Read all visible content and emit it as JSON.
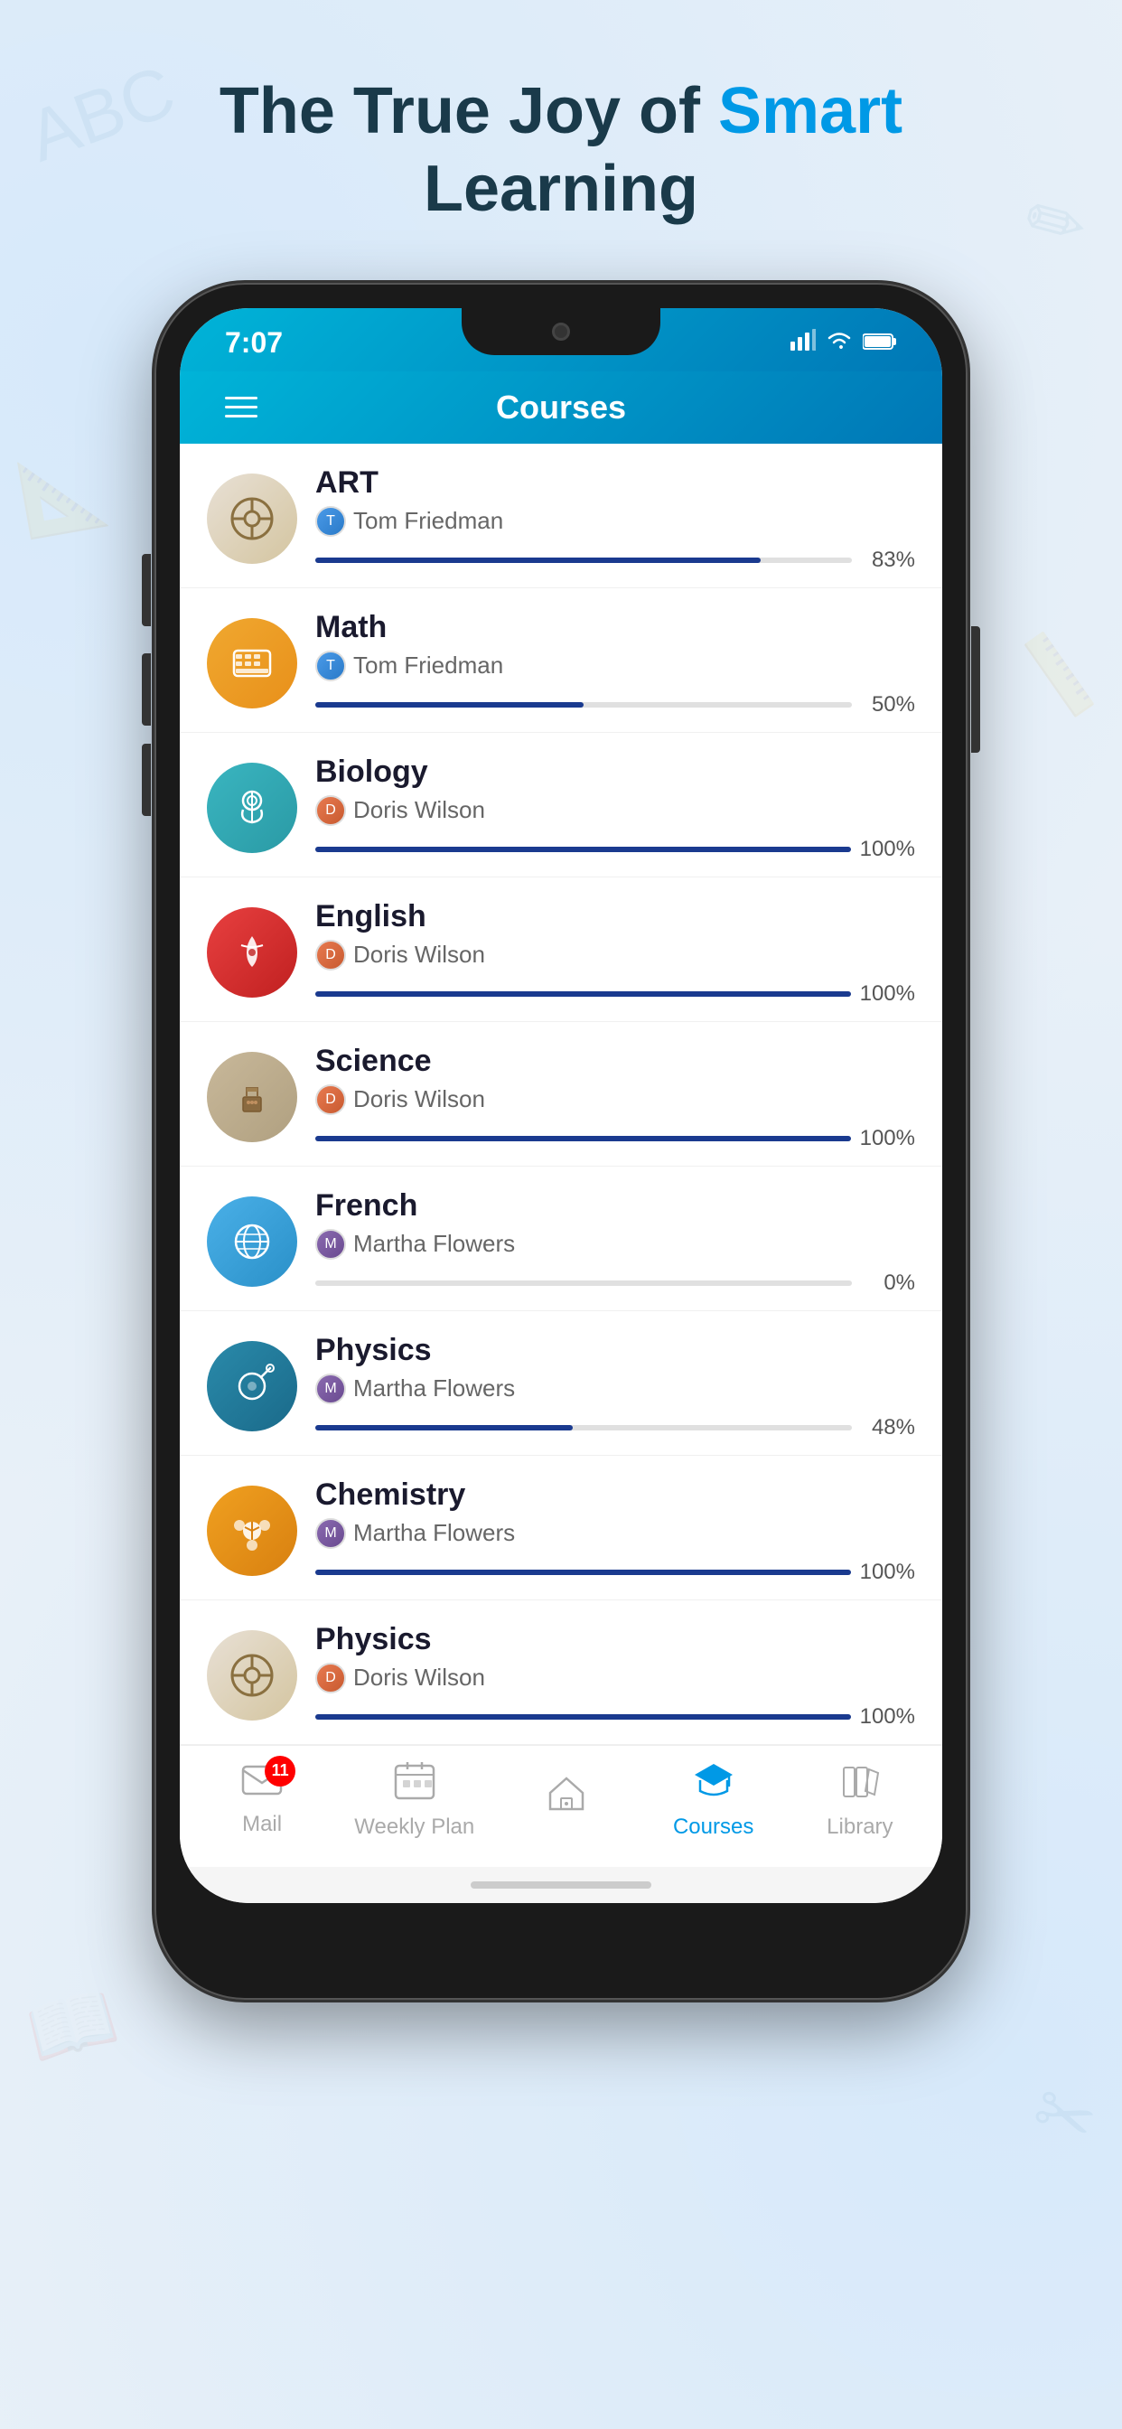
{
  "page": {
    "title_part1": "The True Joy of ",
    "title_highlight": "Smart",
    "title_part2": "Learning"
  },
  "status_bar": {
    "time": "7:07",
    "signal_icon": "signal",
    "wifi_icon": "wifi",
    "battery_icon": "battery"
  },
  "header": {
    "title": "Courses"
  },
  "courses": [
    {
      "name": "ART",
      "teacher": "Tom Friedman",
      "progress": 83,
      "icon_type": "art",
      "icon_symbol": "⚛"
    },
    {
      "name": "Math",
      "teacher": "Tom Friedman",
      "progress": 50,
      "icon_type": "math",
      "icon_symbol": "⌨"
    },
    {
      "name": "Biology",
      "teacher": "Doris Wilson",
      "progress": 100,
      "icon_type": "biology",
      "icon_symbol": "🚴"
    },
    {
      "name": "English",
      "teacher": "Doris Wilson",
      "progress": 100,
      "icon_type": "english",
      "icon_symbol": "🔥"
    },
    {
      "name": "Science",
      "teacher": "Doris Wilson",
      "progress": 100,
      "icon_type": "science",
      "icon_symbol": "💼"
    },
    {
      "name": "French",
      "teacher": "Martha Flowers",
      "progress": 0,
      "icon_type": "french",
      "icon_symbol": "🌍"
    },
    {
      "name": "Physics",
      "teacher": "Martha Flowers",
      "progress": 48,
      "icon_type": "physics-martha",
      "icon_symbol": "🔍"
    },
    {
      "name": "Chemistry",
      "teacher": "Martha Flowers",
      "progress": 100,
      "icon_type": "chemistry",
      "icon_symbol": "✦"
    },
    {
      "name": "Physics",
      "teacher": "Doris Wilson",
      "progress": 100,
      "icon_type": "physics-doris",
      "icon_symbol": "⚛"
    }
  ],
  "tab_bar": {
    "items": [
      {
        "label": "Mail",
        "icon": "✉",
        "active": false,
        "badge": 11
      },
      {
        "label": "Weekly Plan",
        "icon": "📅",
        "active": false,
        "badge": null
      },
      {
        "label": "",
        "icon": "⌂",
        "active": false,
        "badge": null
      },
      {
        "label": "Courses",
        "icon": "🎓",
        "active": true,
        "badge": null
      },
      {
        "label": "Library",
        "icon": "📚",
        "active": false,
        "badge": null
      }
    ]
  }
}
